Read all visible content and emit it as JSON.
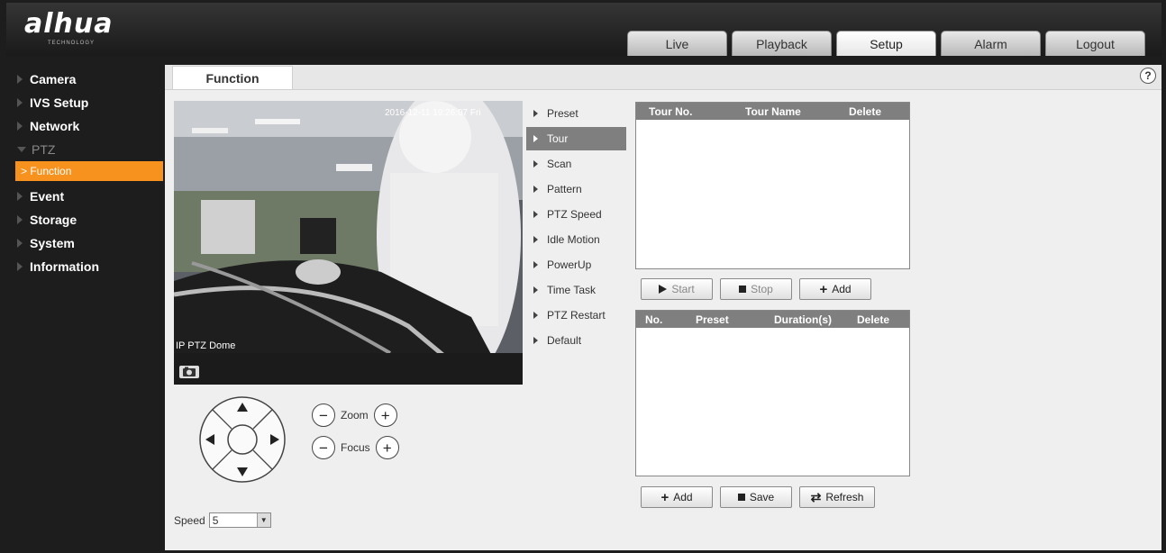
{
  "header": {
    "logo": "alhua",
    "logo_sub": "TECHNOLOGY",
    "tabs": [
      {
        "label": "Live",
        "active": false
      },
      {
        "label": "Playback",
        "active": false
      },
      {
        "label": "Setup",
        "active": true
      },
      {
        "label": "Alarm",
        "active": false
      },
      {
        "label": "Logout",
        "active": false
      }
    ]
  },
  "sidebar": {
    "items": [
      {
        "label": "Camera"
      },
      {
        "label": "IVS Setup"
      },
      {
        "label": "Network"
      },
      {
        "label": "PTZ",
        "expanded": true
      },
      {
        "label": "Event"
      },
      {
        "label": "Storage"
      },
      {
        "label": "System"
      },
      {
        "label": "Information"
      }
    ],
    "sub_item": "> Function",
    "accent_color": "#f7921e"
  },
  "content": {
    "tab_label": "Function",
    "help_icon": "?"
  },
  "video": {
    "osd_time": "2016-12-11 19:26:07 Fri",
    "osd_name": "IP PTZ Dome"
  },
  "ptz": {
    "zoom_label": "Zoom",
    "focus_label": "Focus",
    "speed_label": "Speed",
    "speed_value": "5",
    "minus": "−",
    "plus": "+"
  },
  "function_menu": [
    {
      "label": "Preset",
      "active": false
    },
    {
      "label": "Tour",
      "active": true
    },
    {
      "label": "Scan",
      "active": false
    },
    {
      "label": "Pattern",
      "active": false
    },
    {
      "label": "PTZ Speed",
      "active": false
    },
    {
      "label": "Idle Motion",
      "active": false
    },
    {
      "label": "PowerUp",
      "active": false
    },
    {
      "label": "Time Task",
      "active": false
    },
    {
      "label": "PTZ Restart",
      "active": false
    },
    {
      "label": "Default",
      "active": false
    }
  ],
  "tour_table": {
    "headers": [
      "Tour No.",
      "Tour Name",
      "Delete"
    ],
    "rows": []
  },
  "tour_buttons": {
    "start": "Start",
    "stop": "Stop",
    "add": "Add"
  },
  "preset_table": {
    "headers": [
      "No.",
      "Preset",
      "Duration(s)",
      "Delete"
    ],
    "rows": []
  },
  "preset_buttons": {
    "add": "Add",
    "save": "Save",
    "refresh": "Refresh"
  }
}
